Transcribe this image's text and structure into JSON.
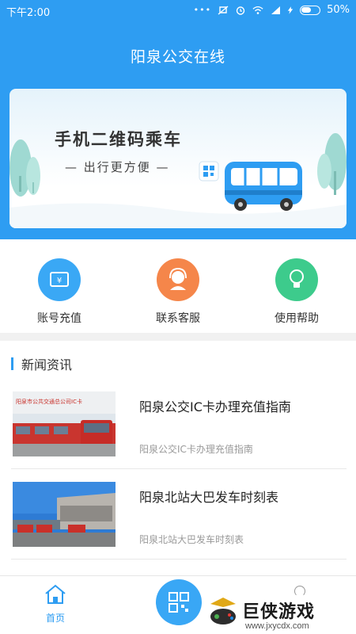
{
  "status_bar": {
    "time": "下午2:00",
    "dots": "•••",
    "battery": "50%"
  },
  "app_title": "阳泉公交在线",
  "banner": {
    "title": "手机二维码乘车",
    "subtitle": "— 出行更方便 —"
  },
  "quick_actions": [
    {
      "label": "账号充值",
      "icon": "wallet-icon",
      "color": "#3aa8f5"
    },
    {
      "label": "联系客服",
      "icon": "customer-service-icon",
      "color": "#f5864a"
    },
    {
      "label": "使用帮助",
      "icon": "lightbulb-icon",
      "color": "#3dcb8c"
    }
  ],
  "news": {
    "header": "新闻资讯",
    "items": [
      {
        "title": "阳泉公交IC卡办理充值指南",
        "desc": "阳泉公交IC卡办理充值指南",
        "thumb_caption": "阳泉市公共交通总公司IC卡"
      },
      {
        "title": "阳泉北站大巴发车时刻表",
        "desc": "阳泉北站大巴发车时刻表"
      }
    ]
  },
  "tabbar": {
    "home_label": "首页"
  },
  "watermark": {
    "text": "巨侠游戏",
    "url": "www.jxycdx.com"
  },
  "colors": {
    "primary": "#2e9df2",
    "accent_orange": "#f5864a",
    "accent_green": "#3dcb8c"
  }
}
